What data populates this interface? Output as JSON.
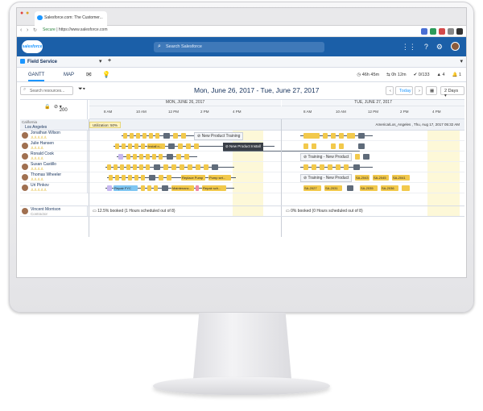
{
  "browser": {
    "tab_title": "Salesforce.com: The Customer...",
    "url_secure_label": "Secure",
    "url": "https://www.salesforce.com"
  },
  "header": {
    "logo_text": "salesforce",
    "search_placeholder": "Search Salesforce"
  },
  "app": {
    "name": "Field Service"
  },
  "tabs": [
    {
      "label": "GANTT",
      "active": true
    },
    {
      "label": "MAP",
      "active": false
    }
  ],
  "stats": {
    "duration": "46h 45m",
    "travel": "0h 12m",
    "completed": "0/133",
    "alerts": "4",
    "notifications": "1"
  },
  "toolbar": {
    "resource_search_placeholder": "Search resources...",
    "date_range": "Mon, June 26, 2017 - Tue, June 27, 2017",
    "today_label": "Today",
    "span_label": "2 Days"
  },
  "gantt": {
    "zoom_value": "200",
    "days": [
      {
        "label": "MON, JUNE 26, 2017"
      },
      {
        "label": "TUE, JUNE 27, 2017"
      }
    ],
    "hours": [
      "8 AM",
      "10 AM",
      "12 PM",
      "2 PM",
      "4 PM",
      "8 AM",
      "10 AM",
      "12 PM",
      "2 PM",
      "4 PM"
    ],
    "region": "California",
    "territory": "Los Angeles",
    "utilization": "Utilization: 50%",
    "timezone": "America/Los_Angeles , Thu, Aug 17, 2017 05:32 AM",
    "resources": [
      {
        "name": "Jonathan Wilson",
        "skills": "♙♙♙♙♙"
      },
      {
        "name": "Julie Hansen",
        "skills": "♙♙♙♙"
      },
      {
        "name": "Ronald Cook",
        "skills": "♙♙♙♙"
      },
      {
        "name": "Susan Castillo",
        "skills": "♙♙♙♙"
      },
      {
        "name": "Thomas Wheeler",
        "skills": "♙♙♙♙"
      },
      {
        "name": "Uri Pinkov",
        "skills": "♙♙♙♙♙"
      }
    ],
    "labels": {
      "new_product_training": "New Product Training",
      "install": "Install n...",
      "new_product_install": "New Product Install",
      "training_new_product_1": "Training - New Product",
      "training_new_product_2": "Training - New Product",
      "replace_pump": "Replace Pump",
      "pump_set": "Pump set...",
      "repair": "Repair FYC",
      "maintenance": "Maintenanc...",
      "repair_sched": "Repair sch...",
      "sa_2027": "SA-2027",
      "sa_2031": "SA-2031",
      "sa_2036": "SA-2036",
      "sa_2043": "SA-2043",
      "sa_2045": "SA-2045",
      "sa_2041": "SA-2041",
      "sa_2035": "SA-2035",
      "sa_2039": "SA-2039"
    },
    "summary_resource": "Vincent Morrison",
    "summary_resource_sub": "Contractor",
    "summary_day1": "12.5% booked (1 Hours scheduled out of 8)",
    "summary_day2": "0% booked (0 Hours scheduled out of 8)"
  }
}
